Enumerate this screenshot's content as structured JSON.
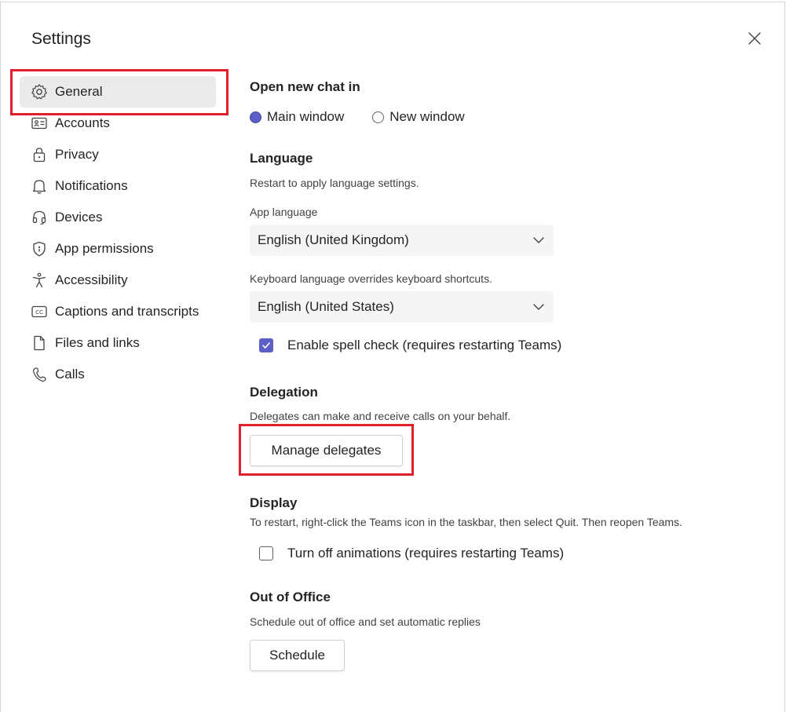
{
  "dialog": {
    "title": "Settings",
    "close_icon": "close-icon"
  },
  "nav": {
    "items": [
      {
        "label": "General",
        "icon": "gear-icon",
        "active": true
      },
      {
        "label": "Accounts",
        "icon": "contact-card-icon"
      },
      {
        "label": "Privacy",
        "icon": "lock-icon"
      },
      {
        "label": "Notifications",
        "icon": "bell-icon"
      },
      {
        "label": "Devices",
        "icon": "headset-icon"
      },
      {
        "label": "App permissions",
        "icon": "shield-icon"
      },
      {
        "label": "Accessibility",
        "icon": "accessibility-icon"
      },
      {
        "label": "Captions and transcripts",
        "icon": "closed-captions-icon"
      },
      {
        "label": "Files and links",
        "icon": "document-icon"
      },
      {
        "label": "Calls",
        "icon": "phone-icon"
      }
    ]
  },
  "open_chat": {
    "heading": "Open new chat in",
    "options": [
      {
        "label": "Main window",
        "selected": true
      },
      {
        "label": "New window",
        "selected": false
      }
    ]
  },
  "language": {
    "heading": "Language",
    "description": "Restart to apply language settings.",
    "app_language_label": "App language",
    "app_language_value": "English (United Kingdom)",
    "keyboard_label": "Keyboard language overrides keyboard shortcuts.",
    "keyboard_value": "English (United States)",
    "spell_check_label": "Enable spell check (requires restarting Teams)",
    "spell_check_checked": true
  },
  "delegation": {
    "heading": "Delegation",
    "description": "Delegates can make and receive calls on your behalf.",
    "button_label": "Manage delegates"
  },
  "display": {
    "heading": "Display",
    "description": "To restart, right-click the Teams icon in the taskbar, then select Quit. Then reopen Teams.",
    "animations_label": "Turn off animations (requires restarting Teams)",
    "animations_checked": false
  },
  "out_of_office": {
    "heading": "Out of Office",
    "description": "Schedule out of office and set automatic replies",
    "button_label": "Schedule"
  },
  "colors": {
    "accent": "#5b5fc7",
    "highlight_box": "#e0212c",
    "nav_active_bg": "#ebebeb"
  }
}
